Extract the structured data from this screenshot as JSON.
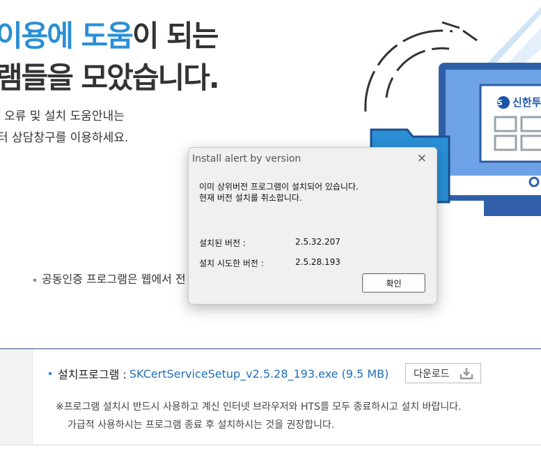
{
  "hero": {
    "line1_blue_a": "이용에 ",
    "line1_blue_b": "도움",
    "line1_dark": "이 되는",
    "line2": "램들을 모았습니다."
  },
  "description": {
    "line1": "l 오류 및 설치 도움안내는",
    "line2": "터 상담창구를 이용하세요."
  },
  "notice": "공동인증 프로그램은 웹에서 전",
  "illustration": {
    "brand_text": "신한투",
    "colors": {
      "monitor": "#2f5fa8",
      "screen": "#6ea2e6",
      "folder": "#2a8fd6"
    }
  },
  "install": {
    "label": "설치프로그램 :",
    "filename": "SKCertServiceSetup_v2.5.28_193.exe (9.5 MB)",
    "download_label": "다운로드",
    "note_line1": "※프로그램 설치시 반드시 사용하고 계신 인터넷 브라우저와 HTS를 모두 종료하시고 설치 바랍니다.",
    "note_line2": "가급적 사용하시는 프로그램 종료 후 설치하시는 것을 권장합니다."
  },
  "dialog": {
    "title": "Install alert by version",
    "message_line1": "이미 상위버전 프로그램이 설치되어 있습니다.",
    "message_line2": "현재 버전 설치를 취소합니다.",
    "installed_label": "설치된 버전 :",
    "installed_value": "2.5.32.207",
    "attempt_label": "설치 시도한 버전 :",
    "attempt_value": "2.5.28.193",
    "ok_label": "확인",
    "close_icon": "close-icon"
  },
  "colors": {
    "accent_blue": "#2a8fd6",
    "link_blue": "#1f6fb8",
    "panel_border": "#2c4d80"
  }
}
